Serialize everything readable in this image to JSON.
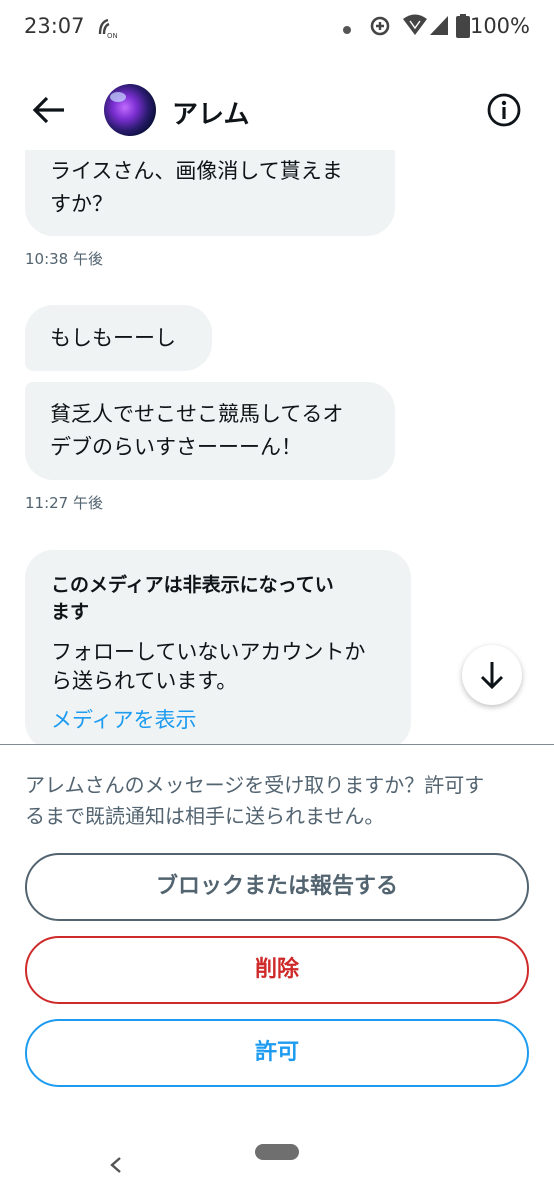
{
  "status_bar": {
    "time": "23:07",
    "battery": "100%",
    "icons": [
      "nfc-icon",
      "dot-icon",
      "data-saver-icon",
      "wifi-icon",
      "signal-icon",
      "battery-icon"
    ]
  },
  "header": {
    "title": "アレム",
    "back_icon": "back-arrow-icon",
    "info_icon": "info-icon"
  },
  "messages": [
    {
      "text_lines": [
        "ライスさん、画像消して貰えま",
        "すか？"
      ]
    },
    {
      "timestamp": "10:38 午後"
    },
    {
      "text_lines": [
        "もしもーーし"
      ]
    },
    {
      "text_lines": [
        "貧乏人でせこせこ競馬してるオ",
        "デブのらいすさーーーん！"
      ]
    },
    {
      "timestamp": "11:27 午後"
    }
  ],
  "media_card": {
    "title_lines": [
      "このメディアは非表示になってい",
      "ます"
    ],
    "subtitle_lines": [
      "フォローしていないアカウントか",
      "ら送られています。"
    ],
    "link": "メディアを表示"
  },
  "request_panel": {
    "prompt_lines": [
      "アレムさんのメッセージを受け取りますか？許可す",
      "るまで既読通知は相手に送られません。"
    ],
    "block_label": "ブロックまたは報告する",
    "delete_label": "削除",
    "allow_label": "許可"
  },
  "colors": {
    "accent": "#1d9bf0",
    "danger": "#cf2a2a",
    "bubble": "#eff3f4",
    "muted_text": "#536471"
  }
}
